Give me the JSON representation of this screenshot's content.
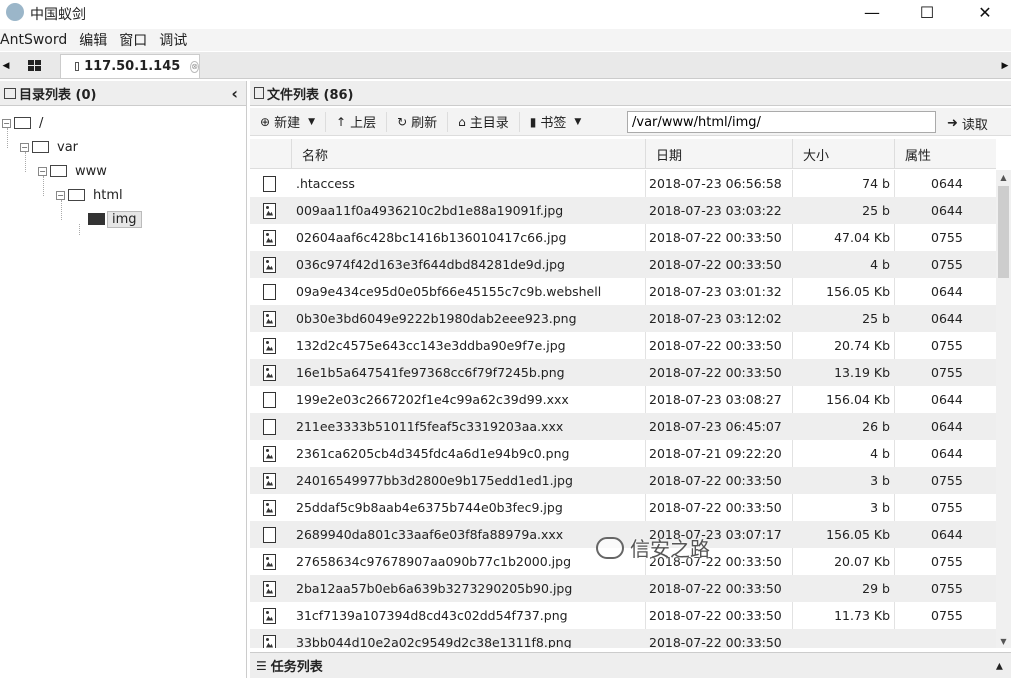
{
  "window": {
    "title": "中国蚁剑",
    "minimize": "—",
    "maximize": "☐",
    "close": "✕"
  },
  "menu": [
    "AntSword",
    "编辑",
    "窗口",
    "调试"
  ],
  "tabs": {
    "host": "117.50.1.145",
    "close": "⊗"
  },
  "left_panel": {
    "header": "目录列表 (0)",
    "collapse": "‹",
    "tree": {
      "root": "/",
      "var": "var",
      "www": "www",
      "html": "html",
      "img": "img"
    }
  },
  "right_panel": {
    "header": "文件列表 (86)",
    "toolbar": {
      "new": "新建",
      "up": "上层",
      "refresh": "刷新",
      "home": "主目录",
      "bookmark": "书签",
      "path": "/var/www/html/img/",
      "read": "读取"
    },
    "columns": {
      "name": "名称",
      "date": "日期",
      "size": "大小",
      "attr": "属性"
    },
    "files": [
      {
        "icon": "file-icon",
        "name": ".htaccess",
        "date": "2018-07-23 06:56:58",
        "size": "74 b",
        "attr": "0644"
      },
      {
        "icon": "image-icon",
        "name": "009aa11f0a4936210c2bd1e88a19091f.jpg",
        "date": "2018-07-23 03:03:22",
        "size": "25 b",
        "attr": "0644"
      },
      {
        "icon": "image-icon",
        "name": "02604aaf6c428bc1416b136010417c66.jpg",
        "date": "2018-07-22 00:33:50",
        "size": "47.04 Kb",
        "attr": "0755"
      },
      {
        "icon": "image-icon",
        "name": "036c974f42d163e3f644dbd84281de9d.jpg",
        "date": "2018-07-22 00:33:50",
        "size": "4 b",
        "attr": "0755"
      },
      {
        "icon": "file-icon",
        "name": "09a9e434ce95d0e05bf66e45155c7c9b.webshell",
        "date": "2018-07-23 03:01:32",
        "size": "156.05 Kb",
        "attr": "0644"
      },
      {
        "icon": "image-icon",
        "name": "0b30e3bd6049e9222b1980dab2eee923.png",
        "date": "2018-07-23 03:12:02",
        "size": "25 b",
        "attr": "0644"
      },
      {
        "icon": "image-icon",
        "name": "132d2c4575e643cc143e3ddba90e9f7e.jpg",
        "date": "2018-07-22 00:33:50",
        "size": "20.74 Kb",
        "attr": "0755"
      },
      {
        "icon": "image-icon",
        "name": "16e1b5a647541fe97368cc6f79f7245b.png",
        "date": "2018-07-22 00:33:50",
        "size": "13.19 Kb",
        "attr": "0755"
      },
      {
        "icon": "file-icon",
        "name": "199e2e03c2667202f1e4c99a62c39d99.xxx",
        "date": "2018-07-23 03:08:27",
        "size": "156.04 Kb",
        "attr": "0644"
      },
      {
        "icon": "file-icon",
        "name": "211ee3333b51011f5feaf5c3319203aa.xxx",
        "date": "2018-07-23 06:45:07",
        "size": "26 b",
        "attr": "0644"
      },
      {
        "icon": "image-icon",
        "name": "2361ca6205cb4d345fdc4a6d1e94b9c0.png",
        "date": "2018-07-21 09:22:20",
        "size": "4 b",
        "attr": "0644"
      },
      {
        "icon": "image-icon",
        "name": "24016549977bb3d2800e9b175edd1ed1.jpg",
        "date": "2018-07-22 00:33:50",
        "size": "3 b",
        "attr": "0755"
      },
      {
        "icon": "image-icon",
        "name": "25ddaf5c9b8aab4e6375b744e0b3fec9.jpg",
        "date": "2018-07-22 00:33:50",
        "size": "3 b",
        "attr": "0755"
      },
      {
        "icon": "file-icon",
        "name": "2689940da801c33aaf6e03f8fa88979a.xxx",
        "date": "2018-07-23 03:07:17",
        "size": "156.05 Kb",
        "attr": "0644"
      },
      {
        "icon": "image-icon",
        "name": "27658634c97678907aa090b77c1b2000.jpg",
        "date": "2018-07-22 00:33:50",
        "size": "20.07 Kb",
        "attr": "0755"
      },
      {
        "icon": "image-icon",
        "name": "2ba12aa57b0eb6a639b3273290205b90.jpg",
        "date": "2018-07-22 00:33:50",
        "size": "29 b",
        "attr": "0755"
      },
      {
        "icon": "image-icon",
        "name": "31cf7139a107394d8cd43c02dd54f737.png",
        "date": "2018-07-22 00:33:50",
        "size": "11.73 Kb",
        "attr": "0755"
      },
      {
        "icon": "image-icon",
        "name": "33bb044d10e2a02c9549d2c38e1311f8.png",
        "date": "2018-07-22 00:33:50",
        "size": "",
        "attr": ""
      }
    ]
  },
  "task_panel": {
    "header": "任务列表"
  },
  "watermark": "信安之路"
}
